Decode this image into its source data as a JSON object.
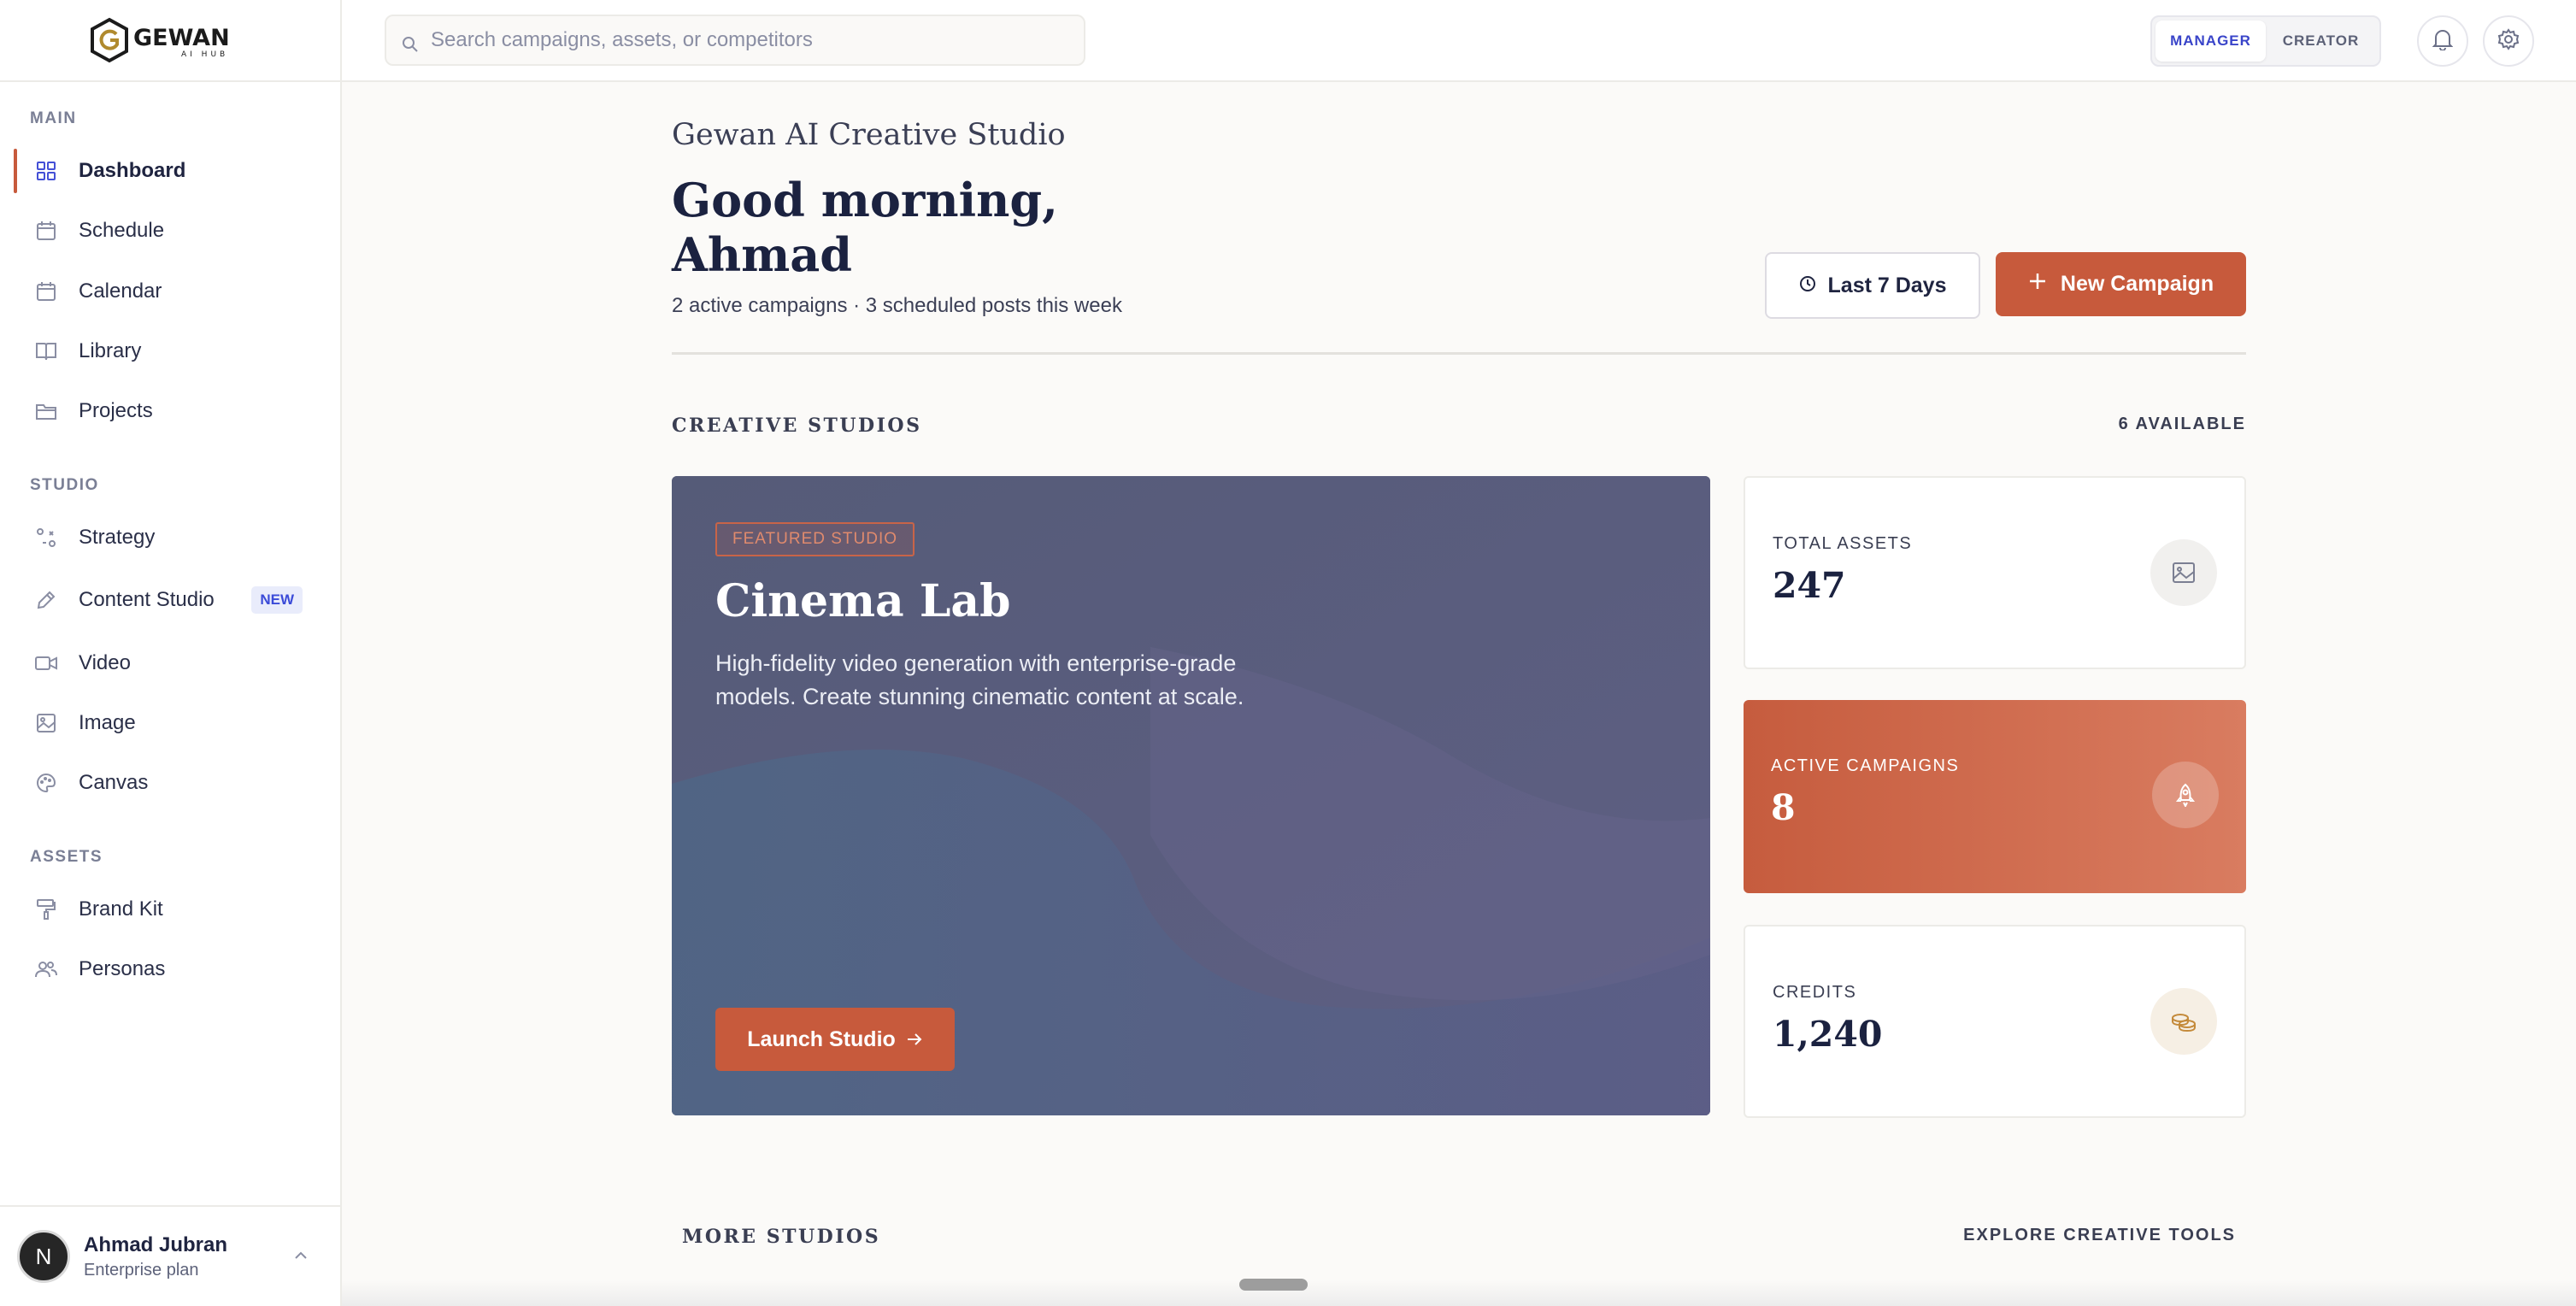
{
  "brand": {
    "logo_text": "GEWAN",
    "logo_sub": "AI HUB",
    "accent": "#c75a3c"
  },
  "sidebar": {
    "sections": [
      {
        "label": "MAIN",
        "items": [
          {
            "label": "Dashboard",
            "icon": "grid-icon",
            "active": true
          },
          {
            "label": "Schedule",
            "icon": "calendar-icon"
          },
          {
            "label": "Calendar",
            "icon": "calendar-icon"
          },
          {
            "label": "Library",
            "icon": "book-icon"
          },
          {
            "label": "Projects",
            "icon": "folder-icon"
          }
        ]
      },
      {
        "label": "STUDIO",
        "items": [
          {
            "label": "Strategy",
            "icon": "strategy-icon"
          },
          {
            "label": "Content Studio",
            "icon": "pen-icon",
            "badge": "NEW"
          },
          {
            "label": "Video",
            "icon": "video-icon"
          },
          {
            "label": "Image",
            "icon": "image-icon"
          },
          {
            "label": "Canvas",
            "icon": "palette-icon"
          }
        ]
      },
      {
        "label": "ASSETS",
        "items": [
          {
            "label": "Brand Kit",
            "icon": "paint-roller-icon"
          },
          {
            "label": "Personas",
            "icon": "users-icon"
          }
        ]
      }
    ],
    "profile": {
      "initial": "N",
      "name": "Ahmad Jubran",
      "plan": "Enterprise plan"
    }
  },
  "topbar": {
    "search_placeholder": "Search campaigns, assets, or competitors",
    "roles": [
      "MANAGER",
      "CREATOR"
    ],
    "selected_role": "MANAGER"
  },
  "header": {
    "studio_name": "Gewan AI Creative Studio",
    "greeting_line1": "Good morning,",
    "greeting_line2": "Ahmad",
    "subline": "2 active campaigns · 3 scheduled posts this week",
    "range_button": "Last 7 Days",
    "new_campaign_button": "New Campaign"
  },
  "creative_studios": {
    "title": "CREATIVE STUDIOS",
    "available": "6 AVAILABLE",
    "featured": {
      "badge": "FEATURED STUDIO",
      "title": "Cinema Lab",
      "description": "High-fidelity video generation with enterprise-grade models. Create stunning cinematic content at scale.",
      "button": "Launch Studio"
    },
    "stats": [
      {
        "label": "TOTAL ASSETS",
        "value": "247",
        "icon": "image-icon"
      },
      {
        "label": "ACTIVE CAMPAIGNS",
        "value": "8",
        "icon": "rocket-icon"
      },
      {
        "label": "CREDITS",
        "value": "1,240",
        "icon": "coins-icon"
      }
    ]
  },
  "more_studios": {
    "title": "MORE STUDIOS",
    "link": "EXPLORE CREATIVE TOOLS"
  }
}
